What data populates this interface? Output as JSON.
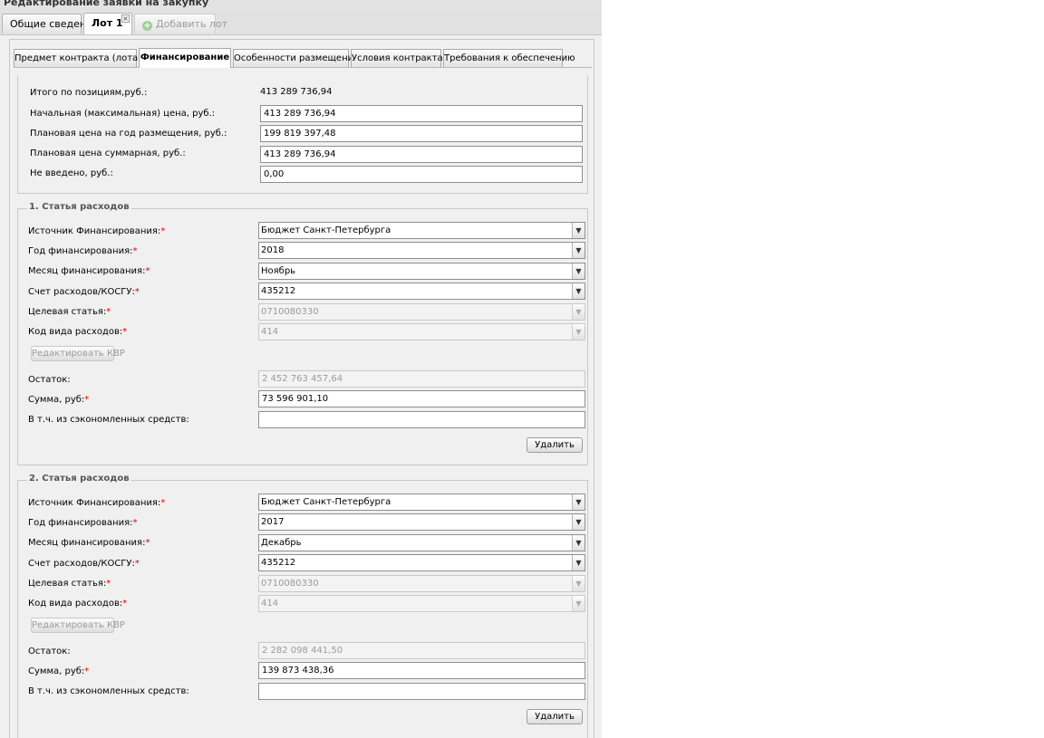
{
  "window": {
    "title": "Редактирование заявки на закупку"
  },
  "top_tabs": [
    {
      "label": "Общие сведения"
    },
    {
      "label": "Лот 1"
    },
    {
      "label": "Добавить лот"
    }
  ],
  "sub_tabs": [
    {
      "label": "Предмет контракта (лота)"
    },
    {
      "label": "Финансирование"
    },
    {
      "label": "Особенности размещения"
    },
    {
      "label": "Условия контракта"
    },
    {
      "label": "Требования к обеспечению"
    }
  ],
  "summary": {
    "total_label": "Итого по позициям,руб.:",
    "total_value": "413 289 736,94",
    "initial_label": "Начальная (максимальная) цена, руб.:",
    "initial_value": "413 289 736,94",
    "plan_year_label": "Плановая цена на год размещения, руб.:",
    "plan_year_value": "199 819 397,48",
    "plan_sum_label": "Плановая цена суммарная, руб.:",
    "plan_sum_value": "413 289 736,94",
    "not_entered_label": "Не введено, руб.:",
    "not_entered_value": "0,00"
  },
  "labels": {
    "source": "Источник Финансирования:",
    "year": "Год финансирования:",
    "month": "Месяц финансирования:",
    "account": "Счет расходов/КОСГУ:",
    "target": "Целевая статья:",
    "kvr": "Код вида расходов:",
    "edit_kvr": "Редактировать КВР",
    "remain": "Остаток:",
    "sum": "Сумма, руб:",
    "saved": "В т.ч. из сэкономленных средств:",
    "delete": "Удалить",
    "required_mark": "*"
  },
  "expense_items": [
    {
      "title": "1. Статья расходов",
      "source": "Бюджет Санкт-Петербурга",
      "year": "2018",
      "month": "Ноябрь",
      "account": "435212",
      "target": "0710080330",
      "kvr": "414",
      "remain": "2 452 763 457,64",
      "sum": "73 596 901,10",
      "saved": ""
    },
    {
      "title": "2. Статья расходов",
      "source": "Бюджет Санкт-Петербурга",
      "year": "2017",
      "month": "Декабрь",
      "account": "435212",
      "target": "0710080330",
      "kvr": "414",
      "remain": "2 282 098 441,50",
      "sum": "139 873 438,36",
      "saved": ""
    }
  ],
  "colors": {
    "required": "#e00000",
    "panel_bg": "#f0f0f0"
  }
}
